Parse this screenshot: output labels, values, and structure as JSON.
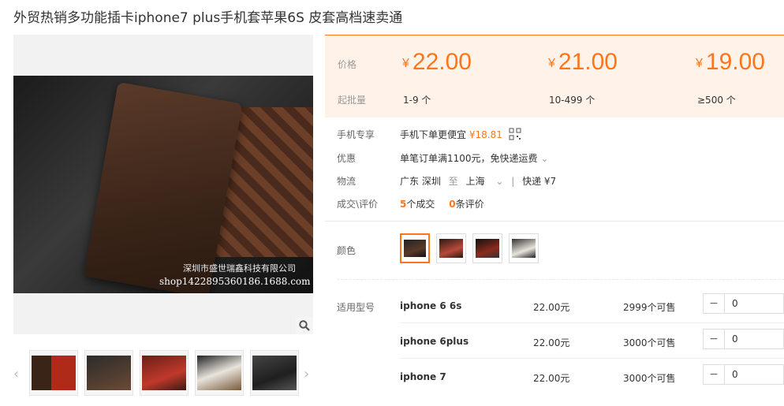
{
  "title": "外贸热销多功能插卡iphone7 plus手机套苹果6S 皮套高档速卖通",
  "image": {
    "caption_line1": "深圳市盛世瑞鑫科技有限公司",
    "caption_line2": "shop1422895360186.1688.com",
    "zoom_icon": "magnifier-icon",
    "thumbnails": [
      "brown-red-case",
      "brown-case",
      "red-case",
      "white-case",
      "dark-case"
    ]
  },
  "price_panel": {
    "price_label": "价格",
    "qty_label": "起批量",
    "currency": "¥",
    "tiers": [
      {
        "price": "22.00",
        "qty": "1-9 个"
      },
      {
        "price": "21.00",
        "qty": "10-499 个"
      },
      {
        "price": "19.00",
        "qty": "≥500 个"
      }
    ]
  },
  "info": {
    "mobile_label": "手机专享",
    "mobile_text": "手机下单更便宜",
    "mobile_price": "¥18.81",
    "promo_label": "优惠",
    "promo_text": "单笔订单满1100元，免快递运费",
    "logistics_label": "物流",
    "from": "广东 深圳",
    "to_word": "至",
    "to": "上海",
    "shipping": "快递 ¥7",
    "deals_label": "成交\\评价",
    "deals_count": "5",
    "deals_text": "个成交",
    "reviews_count": "0",
    "reviews_text": "条评价"
  },
  "color_label": "颜色",
  "model_label": "适用型号",
  "models": [
    {
      "name": "iphone 6 6s",
      "price": "22.00元",
      "stock": "2999个可售",
      "qty": "0"
    },
    {
      "name": "iphone 6plus",
      "price": "22.00元",
      "stock": "3000个可售",
      "qty": "0"
    },
    {
      "name": "iphone 7",
      "price": "22.00元",
      "stock": "3000个可售",
      "qty": "0"
    }
  ],
  "colors": {
    "accent": "#ff7519",
    "panel_bg": "#fff2e8"
  }
}
